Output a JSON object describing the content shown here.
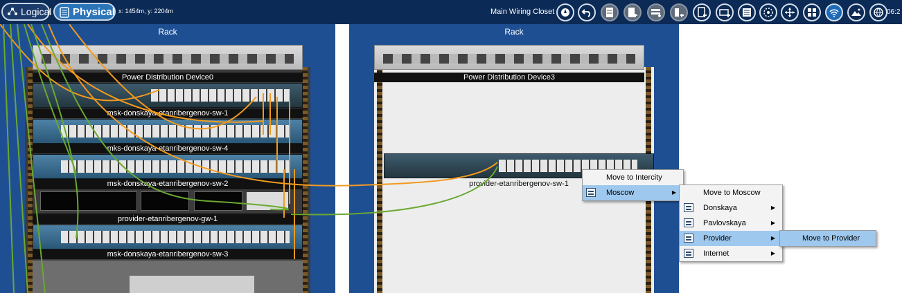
{
  "topbar": {
    "logical_label": "Logical",
    "physical_label": "Physical",
    "coords": "x: 1454m, y: 2204m",
    "location": "Main Wiring Closet",
    "time": "06:2",
    "tools": [
      "navigation-icon",
      "back-icon",
      "rack-icon",
      "new-rack-icon",
      "new-shelf-icon",
      "new-table-icon",
      "new-cabinet-icon",
      "new-container-icon",
      "device-list-icon",
      "cluster-icon",
      "move-icon",
      "grid-icon",
      "wireless-icon",
      "background-image-icon",
      "working-closet-icon"
    ]
  },
  "rack_left": {
    "title": "Rack",
    "devices": [
      {
        "label": "Power Distribution Device0"
      },
      {
        "label": "msk-donskaya-etanribergenov-sw-1"
      },
      {
        "label": "mks-donskaya-etanribergenov-sw-4"
      },
      {
        "label": "msk-donskaya-etanribergenov-sw-2"
      },
      {
        "label": "provider-etanribergenov-gw-1"
      },
      {
        "label": "msk-donskaya-etanribergenov-sw-3"
      }
    ]
  },
  "rack_right": {
    "title": "Rack",
    "devices": [
      {
        "label": "Power Distribution Device3"
      },
      {
        "label": "provider-etanribergenov-sw-1"
      }
    ]
  },
  "context_menu": {
    "level1": [
      {
        "label": "Move to Intercity",
        "arrow": ""
      },
      {
        "label": "Moscow",
        "arrow": "▶"
      }
    ],
    "level2": [
      {
        "label": "Move to Moscow",
        "arrow": ""
      },
      {
        "label": "Donskaya",
        "arrow": "▶"
      },
      {
        "label": "Pavlovskaya",
        "arrow": "▶"
      },
      {
        "label": "Provider",
        "arrow": "▶"
      },
      {
        "label": "Internet",
        "arrow": "▶"
      }
    ],
    "level3": [
      {
        "label": "Move to Provider"
      }
    ]
  },
  "colors": {
    "topbar": "#0b2a55",
    "rack": "#1f4f93",
    "highlight": "#9ec8ee",
    "cable_orange": "#f29a1e",
    "cable_green": "#6aa832"
  }
}
